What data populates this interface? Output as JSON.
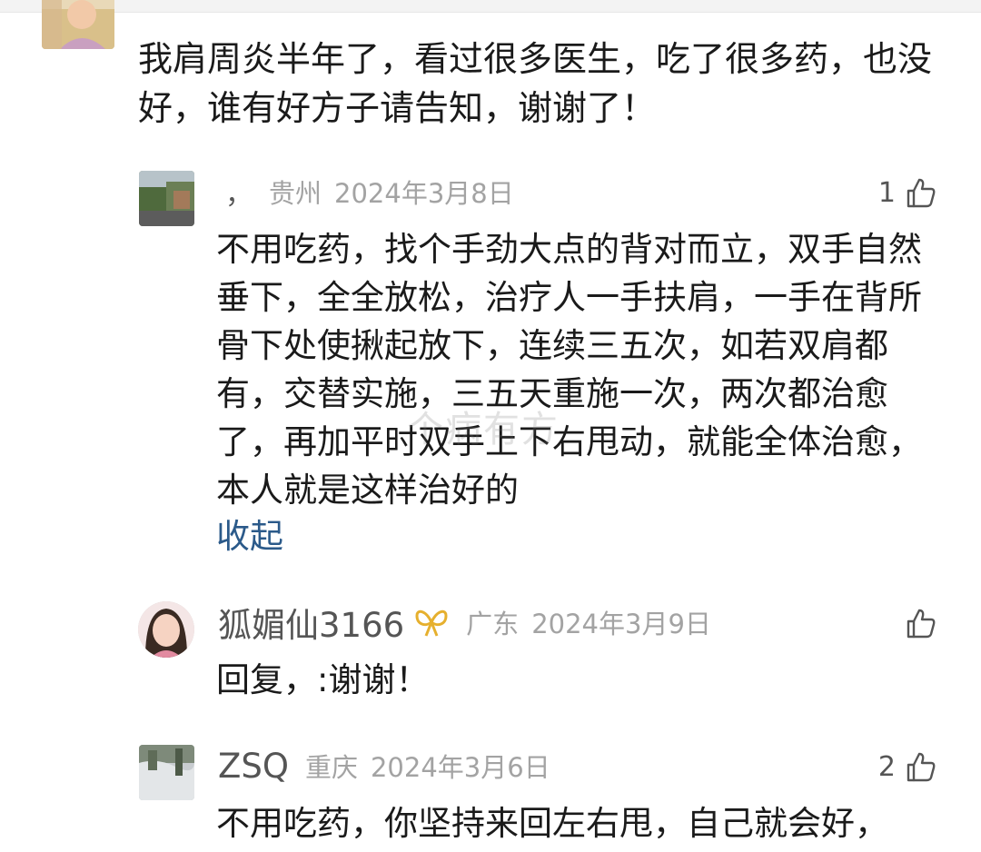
{
  "comment": {
    "text": "我肩周炎半年了，看过很多医生，吃了很多药，也没好，谁有好方子请告知，谢谢了！"
  },
  "replies": [
    {
      "name": "",
      "separator": "，",
      "location": "贵州",
      "date": "2024年3月8日",
      "likes": "1",
      "text": "不用吃药，找个手劲大点的背对而立，双手自然垂下，全全放松，治疗人一手扶肩，一手在背所骨下处使揪起放下，连续三五次，如若双肩都有，交替实施，三五天重施一次，两次都治愈了，再加平时双手上下右甩动，就能全体治愈，本人就是这样治好的",
      "collapse_label": "收起"
    },
    {
      "name": "狐媚仙3166",
      "badge_icon": "vip-ribbon-icon",
      "location": "广东",
      "date": "2024年3月9日",
      "likes": "",
      "text": "回复，:谢谢！"
    },
    {
      "name": "ZSQ",
      "location": "重庆",
      "date": "2024年3月6日",
      "likes": "2",
      "text": "不用吃药，你坚持来回左右甩，自己就会好，"
    }
  ],
  "watermark": "个病有方",
  "colors": {
    "link": "#2b5a8a",
    "meta_gray": "#a3a3a3",
    "name_gray": "#555555",
    "badge_gold": "#e6b02e"
  },
  "icons": {
    "like": "thumbs-up-icon"
  }
}
